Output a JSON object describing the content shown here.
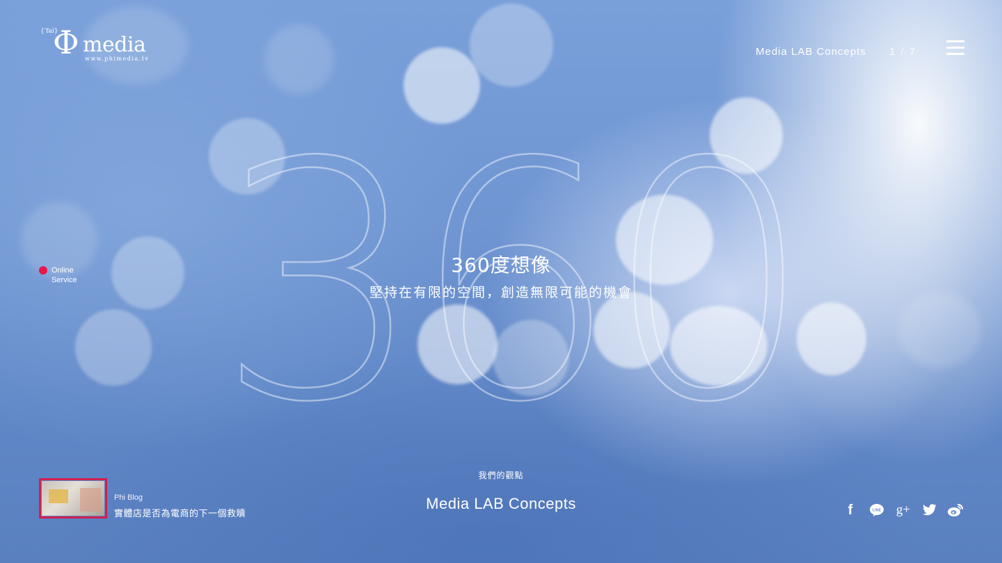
{
  "brand": {
    "phonetic": "{'fai}",
    "symbol": "Φ",
    "name": "media",
    "url": "www.phimedia.tv"
  },
  "header": {
    "nav_link": "Media LAB Concepts",
    "pager": "1 / 7",
    "menu_icon": "hamburger-icon"
  },
  "hero": {
    "big_number": "360",
    "headline": "360度想像",
    "subline": "堅持在有限的空間，創造無限可能的機會"
  },
  "online_service": {
    "label_line1": "Online",
    "label_line2": "Service",
    "dot_color": "#e8174c"
  },
  "blog": {
    "label": "Phi Blog",
    "title": "實體店是否為電商的下一個救贖",
    "frame_color": "#d21f4e"
  },
  "section": {
    "small": "我們的觀點",
    "title": "Media LAB Concepts"
  },
  "social": {
    "facebook": "f",
    "line": "LINE",
    "googleplus": "g+",
    "icons": [
      "facebook-icon",
      "line-icon",
      "google-plus-icon",
      "twitter-icon",
      "weibo-icon"
    ]
  }
}
